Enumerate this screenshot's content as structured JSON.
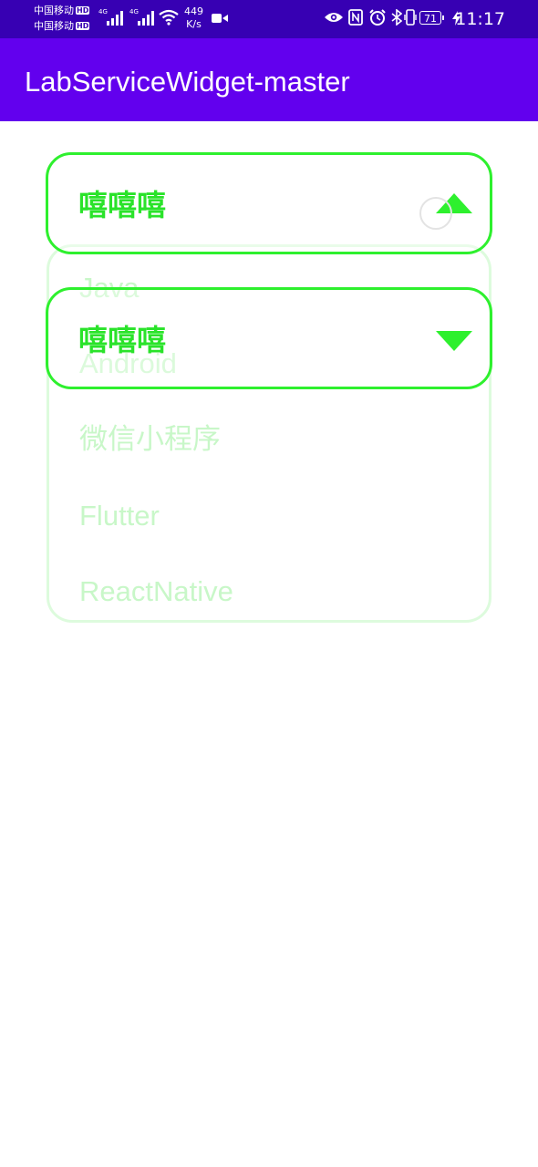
{
  "status_bar": {
    "carrier_1": "中国移动",
    "carrier_2": "中国移动",
    "hd_1": "HD",
    "hd_2": "HD",
    "net_type_1": "4G",
    "net_type_2": "4G",
    "speed_value": "449",
    "speed_unit": "K/s",
    "battery": "71",
    "time": "11:17",
    "icons": [
      "signal-icon",
      "wifi-icon",
      "video-camera-icon",
      "eye-icon",
      "nfc-icon",
      "alarm-icon",
      "bluetooth-icon",
      "vibrate-icon",
      "battery-icon",
      "charging-icon"
    ]
  },
  "app_bar": {
    "title": "LabServiceWidget-master",
    "color": "#6200ee"
  },
  "spinner_top": {
    "label": "嘻嘻嘻",
    "state": "expanded",
    "accent": "#2ef02e"
  },
  "spinner_bottom": {
    "label": "嘻嘻嘻",
    "state": "collapsed",
    "accent": "#2ef02e"
  },
  "options": [
    "Java",
    "Android",
    "微信小程序",
    "Flutter",
    "ReactNative"
  ]
}
